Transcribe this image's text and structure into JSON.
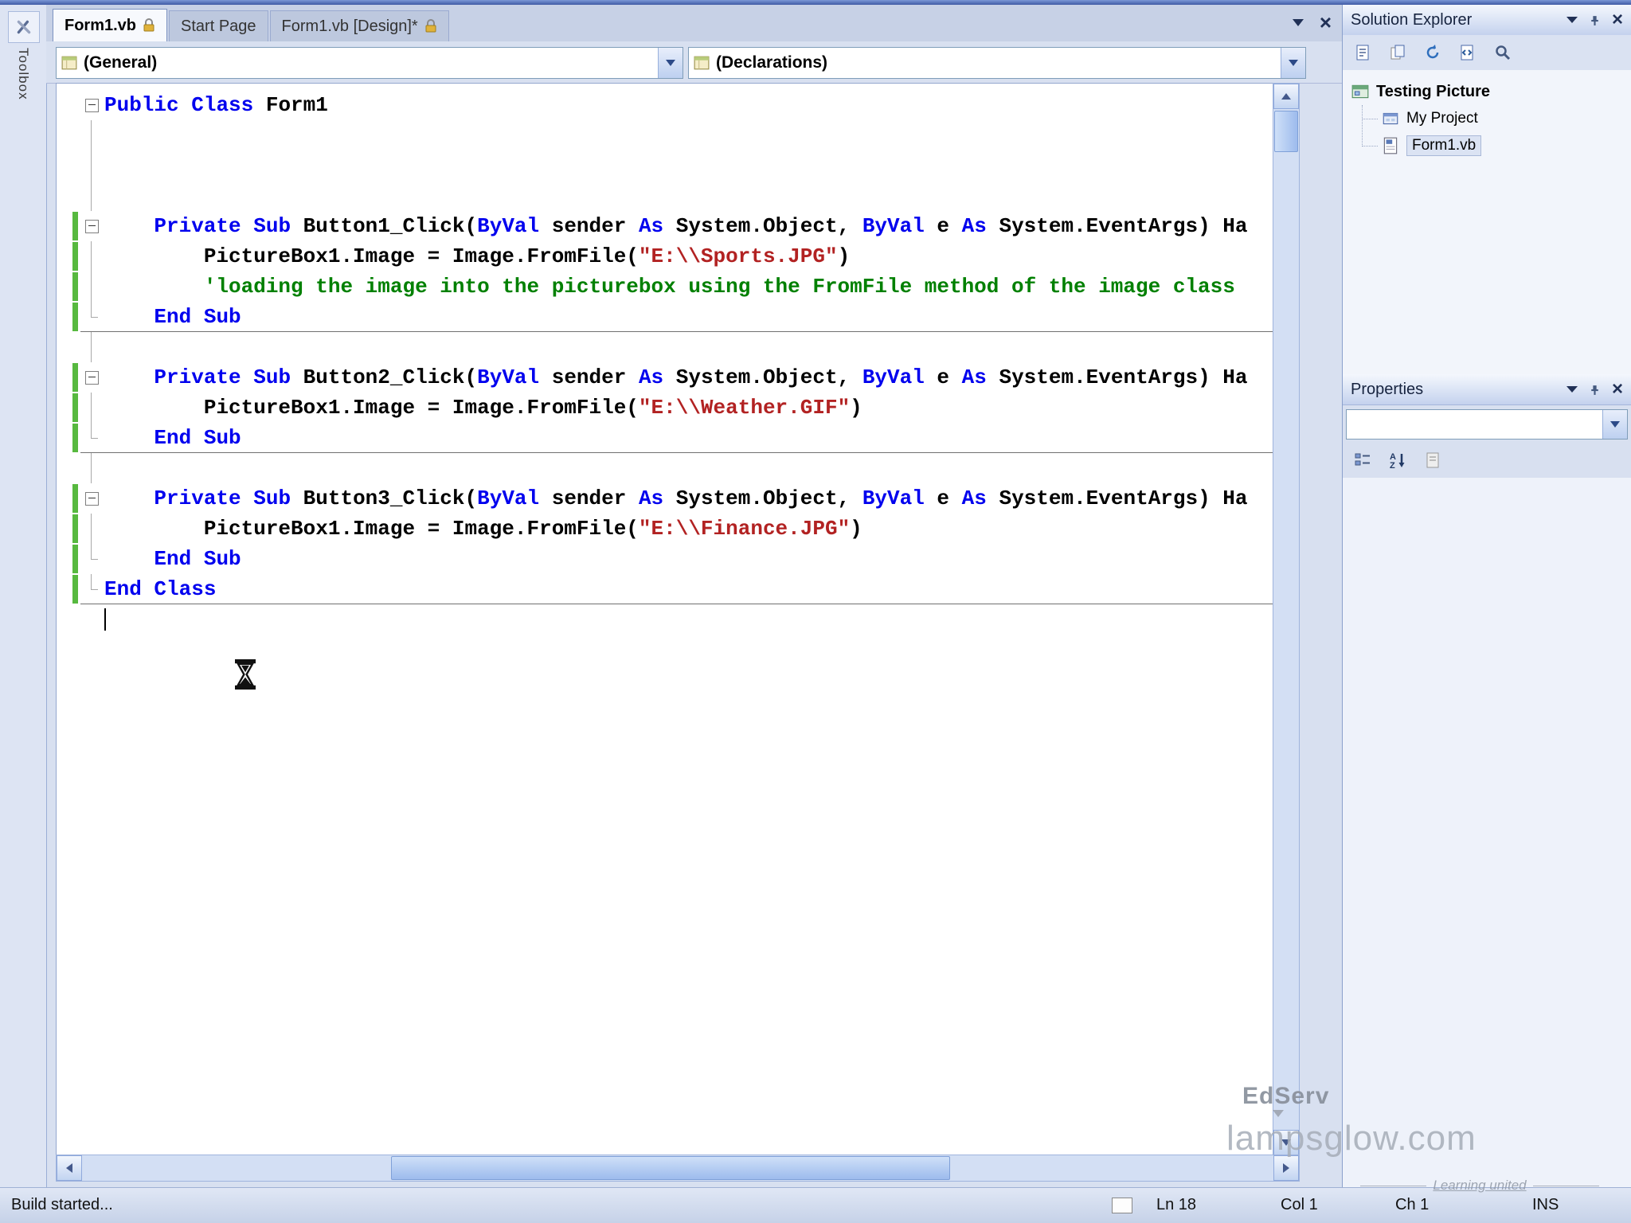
{
  "toolbox": {
    "label": "Toolbox"
  },
  "tabs": {
    "items": [
      {
        "label": "Form1.vb",
        "locked": true,
        "active": true
      },
      {
        "label": "Start Page",
        "locked": false,
        "active": false
      },
      {
        "label": "Form1.vb [Design]*",
        "locked": true,
        "active": false
      }
    ]
  },
  "editor": {
    "left_dropdown": "(General)",
    "right_dropdown": "(Declarations)",
    "lines": [
      {
        "fold": "start",
        "tokens": [
          [
            "k",
            "Public"
          ],
          [
            "p",
            " "
          ],
          [
            "k",
            "Class"
          ],
          [
            "p",
            " Form1"
          ]
        ]
      },
      {
        "fold": "line",
        "tokens": []
      },
      {
        "fold": "line",
        "tokens": []
      },
      {
        "fold": "line",
        "tokens": []
      },
      {
        "fold": "start",
        "changed": true,
        "tokens": [
          [
            "p",
            "    "
          ],
          [
            "k",
            "Private"
          ],
          [
            "p",
            " "
          ],
          [
            "k",
            "Sub"
          ],
          [
            "p",
            " Button1_Click("
          ],
          [
            "k",
            "ByVal"
          ],
          [
            "p",
            " sender "
          ],
          [
            "k",
            "As"
          ],
          [
            "p",
            " System.Object, "
          ],
          [
            "k",
            "ByVal"
          ],
          [
            "p",
            " e "
          ],
          [
            "k",
            "As"
          ],
          [
            "p",
            " System.EventArgs) Ha"
          ]
        ]
      },
      {
        "fold": "line",
        "changed": true,
        "tokens": [
          [
            "p",
            "        PictureBox1.Image = Image.FromFile("
          ],
          [
            "s",
            "\"E:\\\\Sports.JPG\""
          ],
          [
            "p",
            ")"
          ]
        ]
      },
      {
        "fold": "line",
        "changed": true,
        "tokens": [
          [
            "c",
            "        'loading the image into the picturebox using the FromFile method of the image class"
          ]
        ]
      },
      {
        "fold": "end",
        "changed": true,
        "sep": true,
        "tokens": [
          [
            "p",
            "    "
          ],
          [
            "k",
            "End"
          ],
          [
            "p",
            " "
          ],
          [
            "k",
            "Sub"
          ]
        ]
      },
      {
        "fold": "line",
        "tokens": []
      },
      {
        "fold": "start",
        "changed": true,
        "tokens": [
          [
            "p",
            "    "
          ],
          [
            "k",
            "Private"
          ],
          [
            "p",
            " "
          ],
          [
            "k",
            "Sub"
          ],
          [
            "p",
            " Button2_Click("
          ],
          [
            "k",
            "ByVal"
          ],
          [
            "p",
            " sender "
          ],
          [
            "k",
            "As"
          ],
          [
            "p",
            " System.Object, "
          ],
          [
            "k",
            "ByVal"
          ],
          [
            "p",
            " e "
          ],
          [
            "k",
            "As"
          ],
          [
            "p",
            " System.EventArgs) Ha"
          ]
        ]
      },
      {
        "fold": "line",
        "changed": true,
        "tokens": [
          [
            "p",
            "        PictureBox1.Image = Image.FromFile("
          ],
          [
            "s",
            "\"E:\\\\Weather.GIF\""
          ],
          [
            "p",
            ")"
          ]
        ]
      },
      {
        "fold": "end",
        "changed": true,
        "sep": true,
        "tokens": [
          [
            "p",
            "    "
          ],
          [
            "k",
            "End"
          ],
          [
            "p",
            " "
          ],
          [
            "k",
            "Sub"
          ]
        ]
      },
      {
        "fold": "line",
        "tokens": []
      },
      {
        "fold": "start",
        "changed": true,
        "tokens": [
          [
            "p",
            "    "
          ],
          [
            "k",
            "Private"
          ],
          [
            "p",
            " "
          ],
          [
            "k",
            "Sub"
          ],
          [
            "p",
            " Button3_Click("
          ],
          [
            "k",
            "ByVal"
          ],
          [
            "p",
            " sender "
          ],
          [
            "k",
            "As"
          ],
          [
            "p",
            " System.Object, "
          ],
          [
            "k",
            "ByVal"
          ],
          [
            "p",
            " e "
          ],
          [
            "k",
            "As"
          ],
          [
            "p",
            " System.EventArgs) Ha"
          ]
        ]
      },
      {
        "fold": "line",
        "changed": true,
        "tokens": [
          [
            "p",
            "        PictureBox1.Image = Image.FromFile("
          ],
          [
            "s",
            "\"E:\\\\Finance.JPG\""
          ],
          [
            "p",
            ")"
          ]
        ]
      },
      {
        "fold": "end",
        "changed": true,
        "tokens": [
          [
            "p",
            "    "
          ],
          [
            "k",
            "End"
          ],
          [
            "p",
            " "
          ],
          [
            "k",
            "Sub"
          ]
        ]
      },
      {
        "fold": "end",
        "changed": true,
        "sep": true,
        "tokens": [
          [
            "k",
            "End"
          ],
          [
            "p",
            " "
          ],
          [
            "k",
            "Class"
          ]
        ]
      },
      {
        "fold": "none",
        "caret": true,
        "tokens": []
      }
    ]
  },
  "solution_explorer": {
    "title": "Solution Explorer",
    "tree": {
      "root": "Testing Picture",
      "children": [
        "My Project",
        "Form1.vb"
      ]
    }
  },
  "properties_panel": {
    "title": "Properties",
    "selector_value": ""
  },
  "watermark": {
    "brand": "EdServ",
    "site": "lampsglow.com",
    "tagline": "Learning united"
  },
  "status_bar": {
    "message": "Build started...",
    "line": "Ln 18",
    "column": "Col 1",
    "character": "Ch 1",
    "mode": "INS"
  },
  "colors": {
    "keyword": "#0000ee",
    "string": "#b22222",
    "comment": "#008000",
    "change_bar": "#57b93f",
    "chrome": "#d8e0f0"
  }
}
